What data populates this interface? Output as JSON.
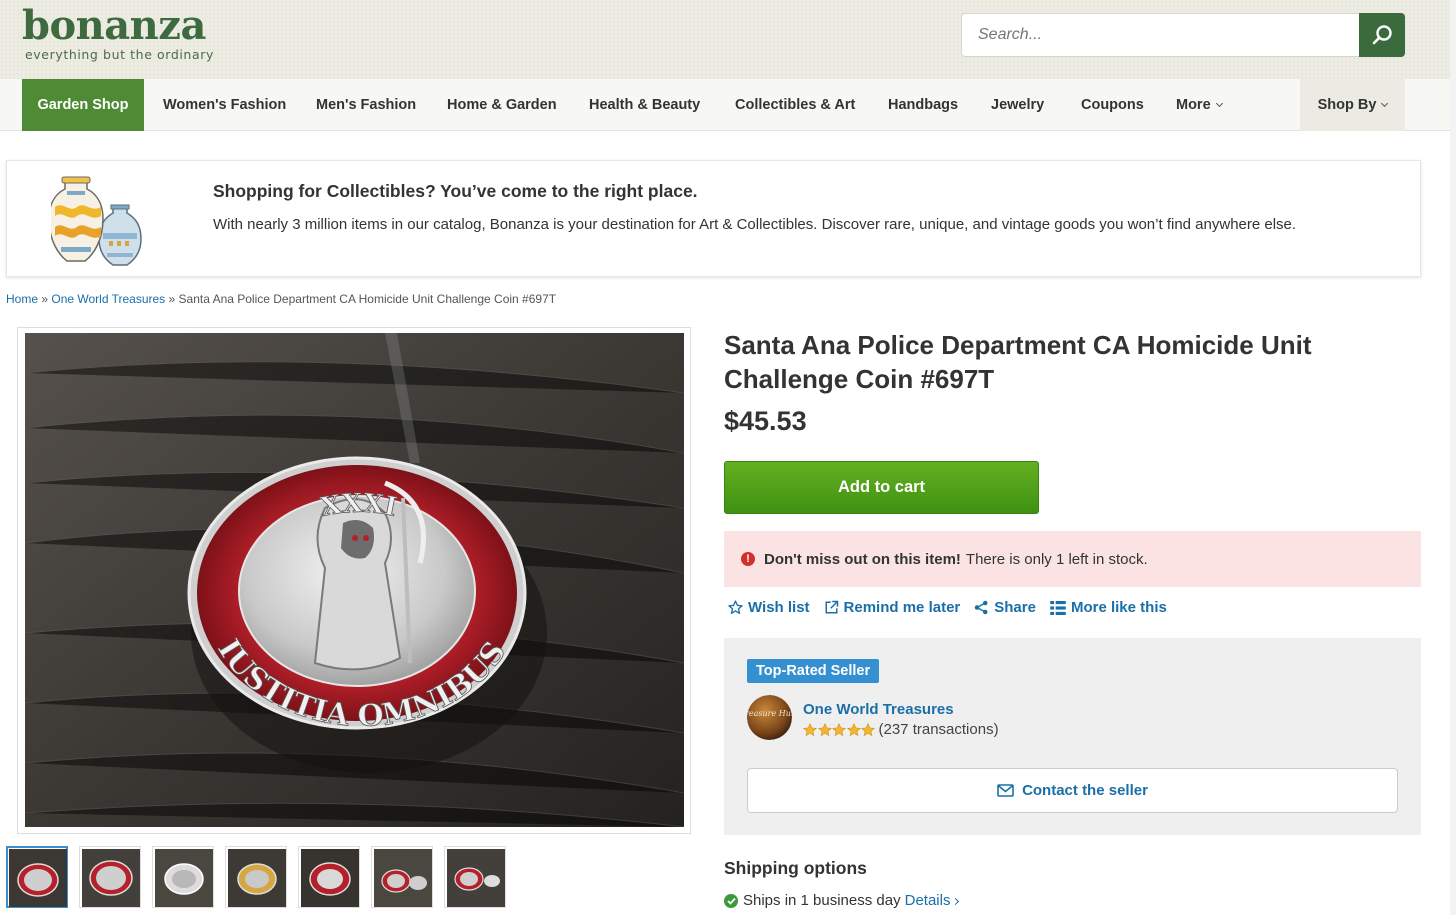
{
  "header": {
    "logo_text": "bonanza",
    "tagline": "everything but the ordinary",
    "search_placeholder": "Search...",
    "search_icon": "search-icon"
  },
  "nav": {
    "items": [
      "Garden Shop",
      "Women's Fashion",
      "Men's Fashion",
      "Home & Garden",
      "Health & Beauty",
      "Collectibles & Art",
      "Handbags",
      "Jewelry",
      "Coupons"
    ],
    "more_label": "More",
    "shop_by_label": "Shop By",
    "active_color": "#4f8b35"
  },
  "promo": {
    "title": "Shopping for Collectibles? You’ve come to the right place.",
    "text": "With nearly 3 million items in our catalog, Bonanza is your destination for Art & Collectibles. Discover rare, unique, and vintage goods you won’t find anywhere else.",
    "icon": "vases-icon"
  },
  "breadcrumb": {
    "home": "Home",
    "sep1": " » ",
    "store": "One World Treasures",
    "sep2": " » ",
    "current": "Santa Ana Police Department CA Homicide Unit Challenge Coin #697T"
  },
  "gallery": {
    "main_image": "challenge-coin-photo",
    "coin_text_top": "XXXI",
    "coin_text_bottom": "IUSTITIA OMNIBUS",
    "thumbnail_count": 7,
    "active_thumbnail": 1
  },
  "product": {
    "title": "Santa Ana Police Department CA Homicide Unit Challenge Coin #697T",
    "price": "$45.53",
    "add_to_cart": "Add to cart",
    "cart_color": "#4f9e18"
  },
  "alert": {
    "bold": "Don't miss out on this item!",
    "text": "There is only 1 left in stock.",
    "color": "#fbe3e3"
  },
  "actions": {
    "wishlist": "Wish list",
    "remind": "Remind me later",
    "share": "Share",
    "more_like": "More like this"
  },
  "seller": {
    "badge": "Top-Rated Seller",
    "name": "One World Treasures",
    "rating_stars": 5,
    "transactions": "(237 transactions)",
    "contact": "Contact the seller",
    "avatar_text": "Treasure Hunt"
  },
  "shipping": {
    "title": "Shipping options",
    "line": "Ships in 1 business day",
    "details": "Details"
  }
}
